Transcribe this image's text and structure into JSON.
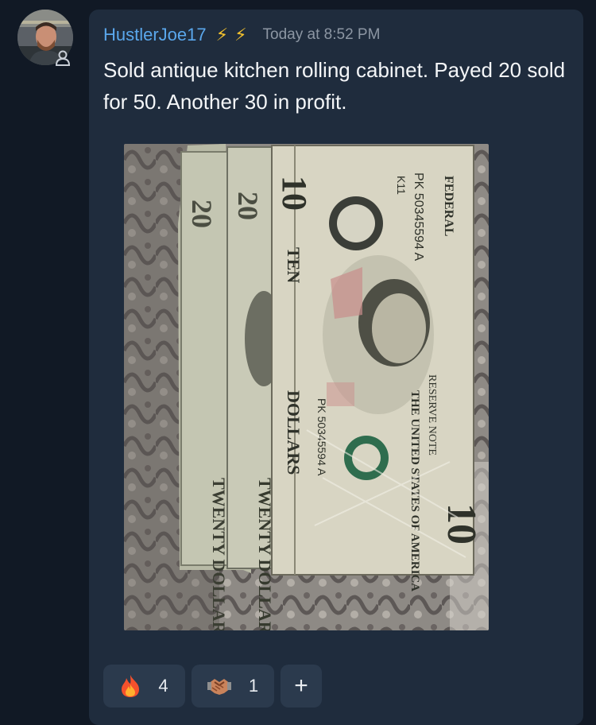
{
  "post": {
    "username": "HustlerJoe17",
    "badges": [
      "lightning-icon",
      "lightning-icon"
    ],
    "badge_color": "#f2c12e",
    "username_color": "#5aa7ec",
    "timestamp": "Today at 8:52 PM",
    "message": "Sold antique kitchen rolling cabinet. Payed 20 sold for 50. Another 30 in profit."
  },
  "photo": {
    "bills": [
      {
        "denomination": "20",
        "text": "TWENTY DOLLARS"
      },
      {
        "denomination": "20",
        "text": "TWENTY DOLLARS"
      },
      {
        "denomination": "10",
        "text": "TEN DOLLARS"
      }
    ],
    "bill_marks": {
      "serial_1": "PK 50345594 A",
      "serial_2": "PK 50345594 A",
      "federal_reserve": "FEDERAL",
      "reserve_note": "RESERVE NOTE",
      "country": "THE UNITED STATES OF AMERICA",
      "plate": "K11",
      "ten_top": "10",
      "ten_bottom": "10",
      "twenty_1": "20",
      "twenty_2": "20",
      "ten_word": "TEN",
      "dollars": "DOLLARS",
      "twenty_text_1": "TWENTY DOLLARS",
      "twenty_text_2": "TWENTY DOLLARS"
    }
  },
  "reactions": [
    {
      "icon": "fire-icon",
      "count": "4"
    },
    {
      "icon": "handshake-icon",
      "count": "1"
    }
  ],
  "add_reaction": {
    "icon": "plus-icon",
    "label": "+"
  }
}
